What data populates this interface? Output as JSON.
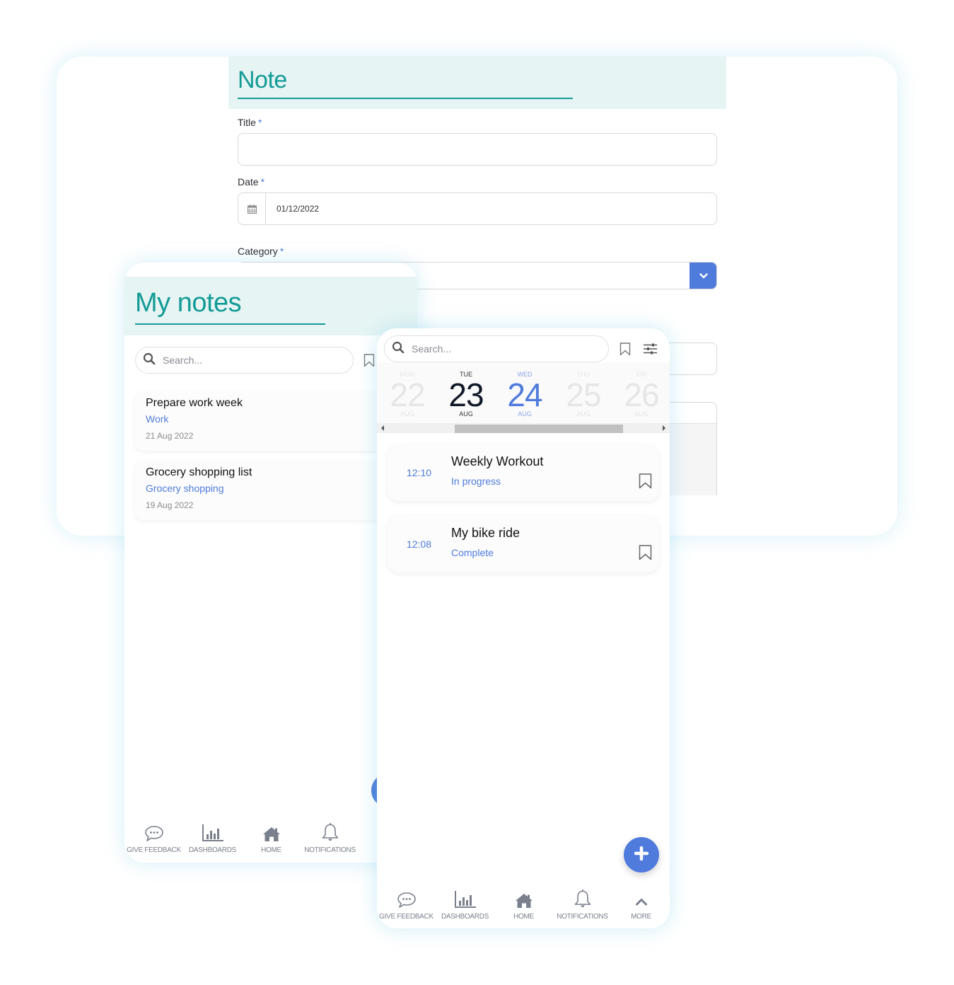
{
  "note_form": {
    "title": "Note",
    "fields": {
      "title": {
        "label": "Title",
        "required_mark": "*",
        "value": ""
      },
      "date": {
        "label": "Date",
        "required_mark": "*",
        "value": "01/12/2022",
        "icon": "calendar-icon"
      },
      "category": {
        "label": "Category",
        "required_mark": "*",
        "value": "",
        "icon": "chevron-down-icon"
      }
    }
  },
  "my_notes": {
    "title": "My notes",
    "search": {
      "placeholder": "Search...",
      "icon": "search-icon"
    },
    "bookmark_icon": "bookmark-icon",
    "notes": [
      {
        "title": "Prepare work week",
        "category": "Work",
        "date": "21 Aug 2022"
      },
      {
        "title": "Grocery shopping list",
        "category": "Grocery shopping",
        "date": "19 Aug 2022"
      }
    ],
    "nav": [
      {
        "label": "GIVE FEEDBACK",
        "icon": "chat-bubble-icon"
      },
      {
        "label": "DASHBOARDS",
        "icon": "bar-chart-icon"
      },
      {
        "label": "HOME",
        "icon": "home-icon"
      },
      {
        "label": "NOTIFICATIONS",
        "icon": "bell-icon"
      }
    ]
  },
  "schedule": {
    "search": {
      "placeholder": "Search...",
      "icon": "search-icon"
    },
    "bookmark_icon": "bookmark-icon",
    "filter_icon": "sliders-icon",
    "days": [
      {
        "weekday": "MON",
        "day": "22",
        "month": "AUG",
        "state": "faded"
      },
      {
        "weekday": "TUE",
        "day": "23",
        "month": "AUG",
        "state": "selected"
      },
      {
        "weekday": "WED",
        "day": "24",
        "month": "AUG",
        "state": "today"
      },
      {
        "weekday": "THU",
        "day": "25",
        "month": "AUG",
        "state": "faded"
      },
      {
        "weekday": "FRI",
        "day": "26",
        "month": "AUG",
        "state": "faded"
      }
    ],
    "items": [
      {
        "time": "12:10",
        "title": "Weekly Workout",
        "status": "In progress"
      },
      {
        "time": "12:08",
        "title": "My bike ride",
        "status": "Complete"
      }
    ],
    "fab_icon": "plus-icon",
    "nav": [
      {
        "label": "GIVE FEEDBACK",
        "icon": "chat-bubble-icon"
      },
      {
        "label": "DASHBOARDS",
        "icon": "bar-chart-icon"
      },
      {
        "label": "HOME",
        "icon": "home-icon"
      },
      {
        "label": "NOTIFICATIONS",
        "icon": "bell-icon"
      },
      {
        "label": "MORE",
        "icon": "chevron-up-icon"
      }
    ]
  },
  "colors": {
    "teal": "#139b95",
    "header_bg": "#e6f4f4",
    "accent_blue": "#4f7bdc",
    "nav_gray": "#7a7f8c"
  }
}
